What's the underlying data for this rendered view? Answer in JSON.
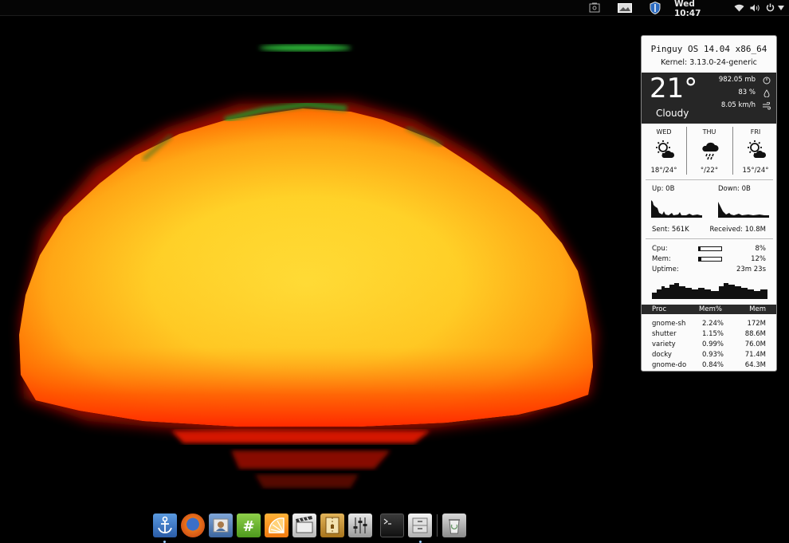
{
  "topbar": {
    "clock": "Wed 10:47",
    "icons": [
      "screenshot-icon",
      "photo-icon",
      "shield-icon",
      "wifi-icon",
      "volume-icon",
      "power-icon",
      "chevron-down-icon"
    ]
  },
  "conky": {
    "os": "Pinguy OS 14.04 x86_64",
    "kernel": "Kernel: 3.13.0-24-generic",
    "weather": {
      "temp": "21°",
      "condition": "Cloudy",
      "pressure": "982.05 mb",
      "humidity": "83 %",
      "wind": "8.05 km/h"
    },
    "forecast": [
      {
        "day": "WED",
        "temp": "18°/24°",
        "icon": "sun-cloud-icon"
      },
      {
        "day": "THU",
        "temp": "°/22°",
        "icon": "rain-cloud-icon"
      },
      {
        "day": "FRI",
        "temp": "15°/24°",
        "icon": "sun-cloud-icon"
      }
    ],
    "network": {
      "up": "Up: 0B",
      "down": "Down: 0B",
      "sent": "Sent: 561K",
      "received": "Received: 10.8M"
    },
    "system": {
      "cpu_label": "Cpu:",
      "cpu_value": "8%",
      "cpu_fraction": 0.08,
      "mem_label": "Mem:",
      "mem_value": "12%",
      "mem_fraction": 0.12,
      "uptime_label": "Uptime:",
      "uptime_value": "23m 23s"
    },
    "processes": {
      "headers": [
        "Proc",
        "Mem%",
        "Mem"
      ],
      "rows": [
        [
          "gnome-sh",
          "2.24%",
          "172M"
        ],
        [
          "shutter",
          "1.15%",
          "88.6M"
        ],
        [
          "variety",
          "0.99%",
          "76.0M"
        ],
        [
          "docky",
          "0.93%",
          "71.4M"
        ],
        [
          "gnome-do",
          "0.84%",
          "64.3M"
        ]
      ]
    }
  },
  "dock": {
    "items": [
      {
        "name": "docky-anchor",
        "color": "#3a78c4"
      },
      {
        "name": "firefox",
        "color": "#e0661a"
      },
      {
        "name": "thunderbird-mail",
        "color": "#5a7fb0"
      },
      {
        "name": "hashtag-chat",
        "color": "#5aa02c"
      },
      {
        "name": "orange-app",
        "color": "#f08a1c"
      },
      {
        "name": "video-editor",
        "color": "#d8d8d8"
      },
      {
        "name": "archive-manager",
        "color": "#c8902a"
      },
      {
        "name": "settings-mixer",
        "color": "#b8b8b8"
      },
      {
        "name": "terminal",
        "color": "#1a1a1a"
      },
      {
        "name": "file-cabinet",
        "color": "#c0c0c0"
      },
      {
        "name": "trash",
        "color": "#a8a8a8"
      }
    ]
  }
}
